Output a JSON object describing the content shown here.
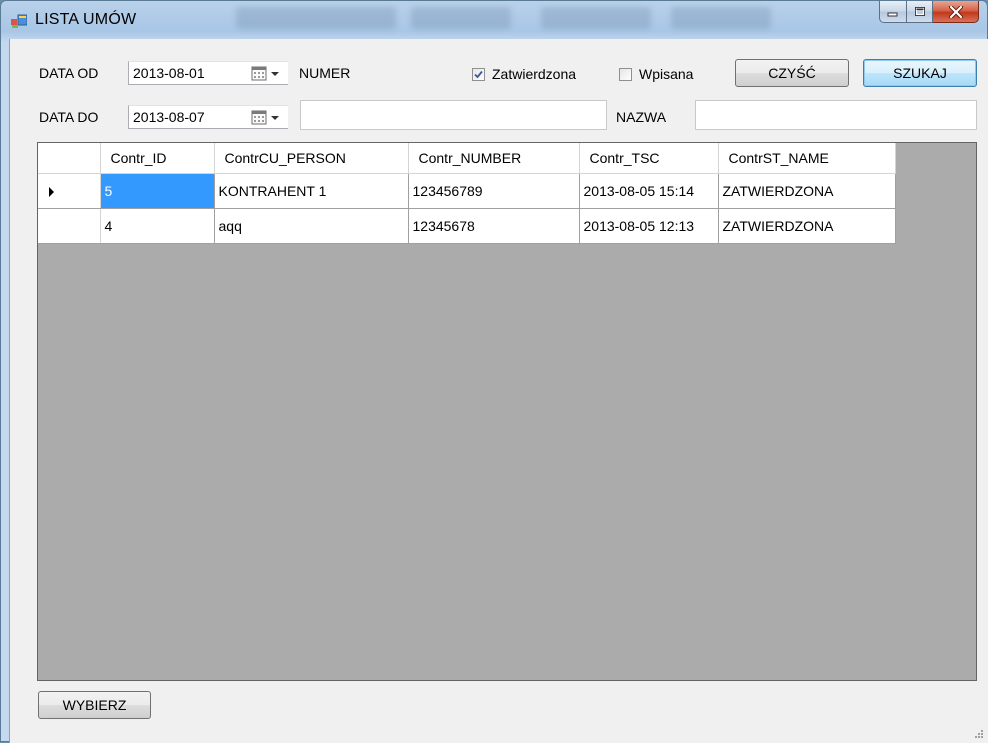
{
  "window": {
    "title": "LISTA UMÓW"
  },
  "filters": {
    "date_from_label": "DATA OD",
    "date_from_value": "2013-08-01",
    "date_to_label": "DATA DO",
    "date_to_value": "2013-08-07",
    "number_label": "NUMER",
    "number_value": "",
    "name_label": "NAZWA",
    "name_value": "",
    "approved_label": "Zatwierdzona",
    "approved_checked": true,
    "entered_label": "Wpisana",
    "entered_checked": false
  },
  "buttons": {
    "clear_label": "CZYŚĆ",
    "search_label": "SZUKAJ",
    "select_label": "WYBIERZ"
  },
  "grid": {
    "columns": [
      "Contr_ID",
      "ContrCU_PERSON",
      "Contr_NUMBER",
      "Contr_TSC",
      "ContrST_NAME"
    ],
    "rows": [
      [
        "5",
        "KONTRAHENT 1",
        "123456789",
        "2013-08-05 15:14",
        "ZATWIERDZONA"
      ],
      [
        "4",
        "aqq",
        "12345678",
        "2013-08-05 12:13",
        "ZATWIERDZONA"
      ]
    ]
  },
  "colors": {
    "selection": "#3399ff",
    "grid_background": "#ababab",
    "form_background": "#f0f0f0"
  }
}
